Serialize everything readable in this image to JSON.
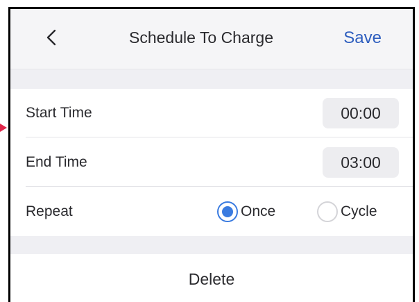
{
  "header": {
    "title": "Schedule To Charge",
    "save_label": "Save",
    "back_icon": "chevron-left-icon"
  },
  "settings": {
    "start_time": {
      "label": "Start Time",
      "value": "00:00"
    },
    "end_time": {
      "label": "End Time",
      "value": "03:00"
    },
    "repeat": {
      "label": "Repeat",
      "options": [
        {
          "label": "Once",
          "selected": true
        },
        {
          "label": "Cycle",
          "selected": false
        }
      ]
    }
  },
  "actions": {
    "delete_label": "Delete"
  },
  "colors": {
    "accent": "#2f5fbf",
    "radio_active": "#3a7be0",
    "background_band": "#efeff3",
    "pointer_marker": "#e0264a"
  }
}
